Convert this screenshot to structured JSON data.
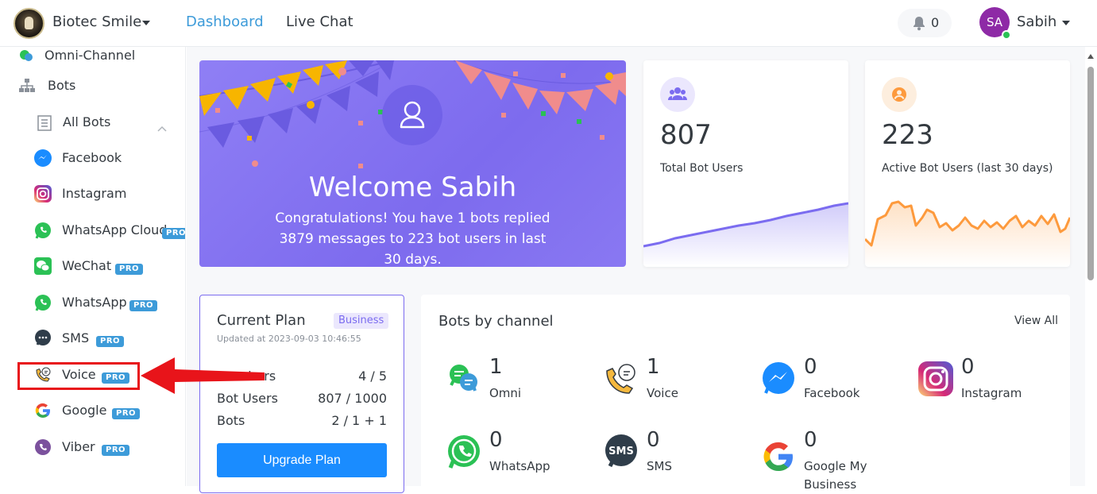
{
  "header": {
    "brand": "Biotec Smile",
    "nav": {
      "dashboard": "Dashboard",
      "live_chat": "Live Chat"
    },
    "notifications": "0",
    "user_initials": "SA",
    "user_name": "Sabih"
  },
  "sidebar": {
    "items": [
      {
        "label": "Omni-Channel",
        "icon": "omni-channel-icon"
      },
      {
        "label": "Bots",
        "icon": "bots-icon"
      },
      {
        "label": "All Bots",
        "icon": "list-icon"
      },
      {
        "label": "Facebook",
        "icon": "messenger-icon"
      },
      {
        "label": "Instagram",
        "icon": "instagram-icon"
      },
      {
        "label": "WhatsApp Cloud",
        "icon": "whatsapp-icon",
        "badge": "PRO"
      },
      {
        "label": "WeChat",
        "icon": "wechat-icon",
        "badge": "PRO"
      },
      {
        "label": "WhatsApp",
        "icon": "whatsapp-icon",
        "badge": "PRO"
      },
      {
        "label": "SMS",
        "icon": "sms-icon",
        "badge": "PRO"
      },
      {
        "label": "Voice",
        "icon": "voice-icon",
        "badge": "PRO"
      },
      {
        "label": "Google",
        "icon": "google-icon",
        "badge": "PRO"
      },
      {
        "label": "Viber",
        "icon": "viber-icon",
        "badge": "PRO"
      }
    ]
  },
  "welcome": {
    "title": "Welcome Sabih",
    "text": "Congratulations! You have 1 bots replied 3879 messages to 223 bot users in last 30 days."
  },
  "stats": {
    "total": {
      "value": "807",
      "label": "Total Bot Users",
      "color": "#7b6cf0"
    },
    "active": {
      "value": "223",
      "label": "Active Bot Users (last 30 days)",
      "color": "#fd9a3d"
    }
  },
  "plan": {
    "title": "Current Plan",
    "badge": "Business",
    "updated": "Updated at 2023-09-03 10:46:55",
    "rows": [
      {
        "label": "Members",
        "value": "4 / 5"
      },
      {
        "label": "Bot Users",
        "value": "807 / 1000"
      },
      {
        "label": "Bots",
        "value": "2 / 1 + 1"
      }
    ],
    "upgrade": "Upgrade Plan"
  },
  "channels": {
    "title": "Bots by channel",
    "view_all": "View All",
    "items": [
      {
        "label": "Omni",
        "count": "1",
        "icon": "omni-icon"
      },
      {
        "label": "Voice",
        "count": "1",
        "icon": "voice-icon"
      },
      {
        "label": "Facebook",
        "count": "0",
        "icon": "messenger-icon"
      },
      {
        "label": "Instagram",
        "count": "0",
        "icon": "instagram-icon"
      },
      {
        "label": "WhatsApp",
        "count": "0",
        "icon": "whatsapp-icon"
      },
      {
        "label": "SMS",
        "count": "0",
        "icon": "sms-icon"
      },
      {
        "label": "Google My Business",
        "count": "0",
        "icon": "google-icon"
      }
    ]
  },
  "colors": {
    "accent": "#3d9bd9",
    "brand_purple": "#7b6cf0",
    "button_blue": "#1a8cff",
    "highlight_red": "#e8141a"
  }
}
